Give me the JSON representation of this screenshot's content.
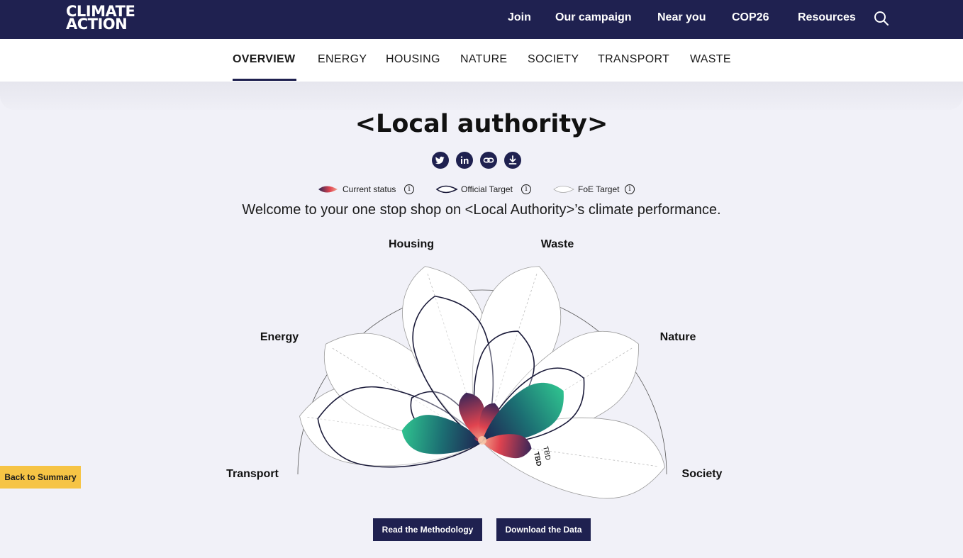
{
  "header": {
    "logo_line1": "CLIMATE",
    "logo_line2": "ACTION",
    "nav": [
      "Join",
      "Our campaign",
      "Near you",
      "COP26",
      "Resources"
    ],
    "search_icon": "search-icon"
  },
  "subnav": {
    "tabs": [
      "OVERVIEW",
      "ENERGY",
      "HOUSING",
      "NATURE",
      "SOCIETY",
      "TRANSPORT",
      "WASTE"
    ],
    "active": "OVERVIEW"
  },
  "page": {
    "title": "<Local authority>",
    "share_icons": [
      "twitter-icon",
      "linkedin-icon",
      "link-icon",
      "download-icon"
    ],
    "welcome": "Welcome to your one stop shop on <Local Authority>’s climate performance."
  },
  "legend": {
    "current": "Current status",
    "official": "Official Target",
    "foe": "FoE Target",
    "info_symbol": "i"
  },
  "chart_data": {
    "type": "radial-petal",
    "categories": [
      "Transport",
      "Energy",
      "Housing",
      "Waste",
      "Nature",
      "Society"
    ],
    "series": [
      {
        "name": "Current status",
        "values": [
          0.44,
          0.05,
          0.28,
          0.22,
          0.52,
          0.27
        ]
      },
      {
        "name": "Official Target",
        "values": [
          0.9,
          0.45,
          0.83,
          0.63,
          0.65,
          null
        ]
      },
      {
        "name": "FoE Target",
        "values": [
          1.0,
          1.0,
          1.0,
          1.0,
          1.0,
          1.0
        ]
      }
    ],
    "annotations": [
      "TBD",
      "TBD"
    ],
    "colors": {
      "current_red": "#e0434f",
      "current_navy": "#1f2150",
      "current_green": "#2db586",
      "official_outline": "#1b1b3a",
      "foe_fill": "#ffffff"
    }
  },
  "buttons": {
    "methodology": "Read the Methodology",
    "download": "Download the Data",
    "back": "Back to Summary"
  }
}
